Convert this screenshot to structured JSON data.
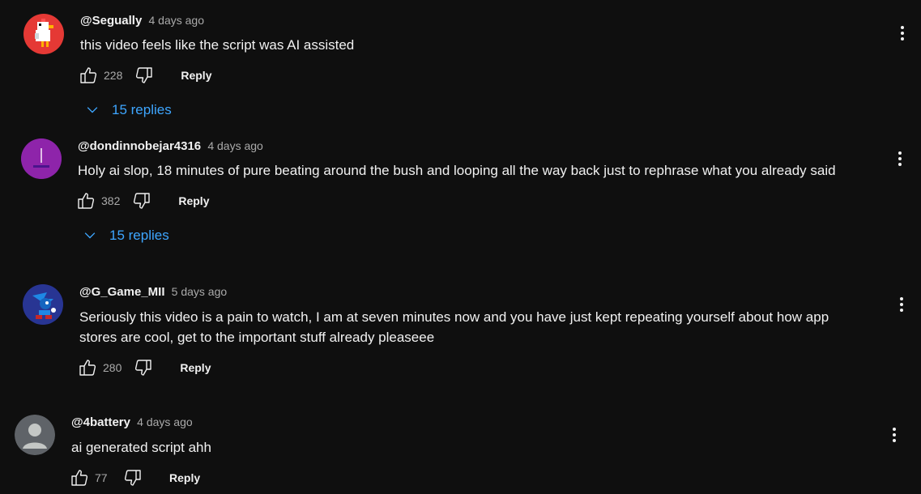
{
  "comments": [
    {
      "author": "@Segually",
      "time": "4 days ago",
      "text": "this video feels like the script was AI assisted",
      "likes": "228",
      "reply_label": "Reply",
      "replies_label": "15 replies",
      "avatar": "chicken-pixel-avatar"
    },
    {
      "author": "@dondinnobejar4316",
      "time": "4 days ago",
      "text": "Holy ai slop, 18 minutes of pure beating around the bush and looping all the way back just to rephrase what you already said",
      "likes": "382",
      "reply_label": "Reply",
      "replies_label": "15 replies",
      "avatar": "purple-avatar"
    },
    {
      "author": "@G_Game_MII",
      "time": "5 days ago",
      "text_line1": "Seriously this video is a pain to watch, I am at seven minutes now and you have just kept repeating yourself about how app",
      "text_line2": "stores are cool, get to the important stuff already pleaseee",
      "likes": "280",
      "reply_label": "Reply",
      "avatar": "sonic-avatar"
    },
    {
      "author": "@4battery",
      "time": "4 days ago",
      "text": "ai generated script ahh",
      "likes": "77",
      "reply_label": "Reply",
      "avatar": "default-user-avatar"
    }
  ],
  "colors": {
    "background": "#0f0f0f",
    "link_blue": "#3ea6ff",
    "muted": "#aaaaaa"
  }
}
